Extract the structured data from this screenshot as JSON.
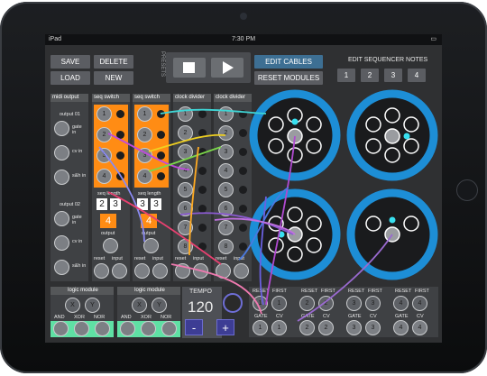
{
  "status_bar": {
    "carrier": "iPad ",
    "time": "7:30 PM"
  },
  "toolbar": {
    "save": "SAVE",
    "delete": "DELETE",
    "load": "LOAD",
    "new": "NEW",
    "presets": "PRESETS",
    "edit_cables": "EDIT CABLES",
    "reset_modules": "RESET MODULES",
    "edit_seq_notes": "EDIT SEQUENCER NOTES",
    "notes": [
      "1",
      "2",
      "3",
      "4"
    ]
  },
  "midi_output": {
    "title": "midi output",
    "output1": "output 01",
    "output2": "output 02",
    "gate_in": "gate in",
    "cv_in": "cv in",
    "sh_in": "s&h in"
  },
  "seq_switch": {
    "title": "seq switch",
    "seq_length": "seq length",
    "output": "output",
    "reset": "reset",
    "input": "input",
    "len_a": [
      "2",
      "3"
    ],
    "len_b": [
      "3",
      "3"
    ],
    "big": "4"
  },
  "clock_divider": {
    "title": "clock divider",
    "numbers": [
      "1",
      "2",
      "3",
      "4",
      "5",
      "6",
      "7",
      "8"
    ],
    "reset": "reset",
    "input": "input"
  },
  "logic": {
    "title": "logic module",
    "x": "X",
    "y": "Y",
    "and": "AND",
    "xor": "XOR",
    "nor": "NOR"
  },
  "tempo": {
    "label": "TEMPO",
    "value": "120",
    "minus": "-",
    "plus": "+"
  },
  "seq_bottom": {
    "reset": "RESET",
    "first": "FIRST",
    "gate": "GATE",
    "cv": "CV"
  }
}
